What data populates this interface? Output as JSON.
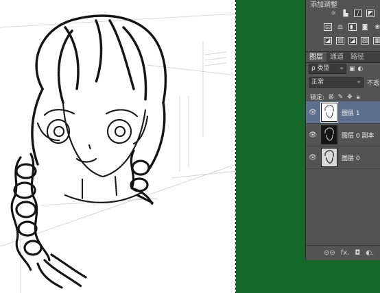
{
  "adjustments": {
    "title": "添加调整",
    "row1_icons": [
      "brightness-icon",
      "levels-icon",
      "curves-icon",
      "exposure-icon"
    ],
    "row2_icons": [
      "vibrance-icon",
      "balance-icon",
      "bw-icon",
      "photo-filter-icon",
      "channel-mixer-icon"
    ],
    "row3_icons": [
      "invert-icon",
      "posterize-icon",
      "threshold-icon",
      "selective-color-icon",
      "gradient-map-icon"
    ]
  },
  "tabs": [
    "图层",
    "通道",
    "路径"
  ],
  "filter": {
    "label": "ρ 类型",
    "arrow": "÷"
  },
  "blend": {
    "mode": "正常",
    "arrow": "÷",
    "opacity_label": "不透"
  },
  "lock": {
    "label": "锁定:"
  },
  "layers": [
    {
      "name": "图层 1",
      "selected": true,
      "thumb": "white"
    },
    {
      "name": "图层 0 副本",
      "selected": false,
      "thumb": "dark"
    },
    {
      "name": "图层 0",
      "selected": false,
      "thumb": "grey"
    }
  ],
  "bottom": {
    "link": "⊖⊖",
    "fx": "fx.",
    "mask": "◘",
    "adjust": "◐."
  }
}
